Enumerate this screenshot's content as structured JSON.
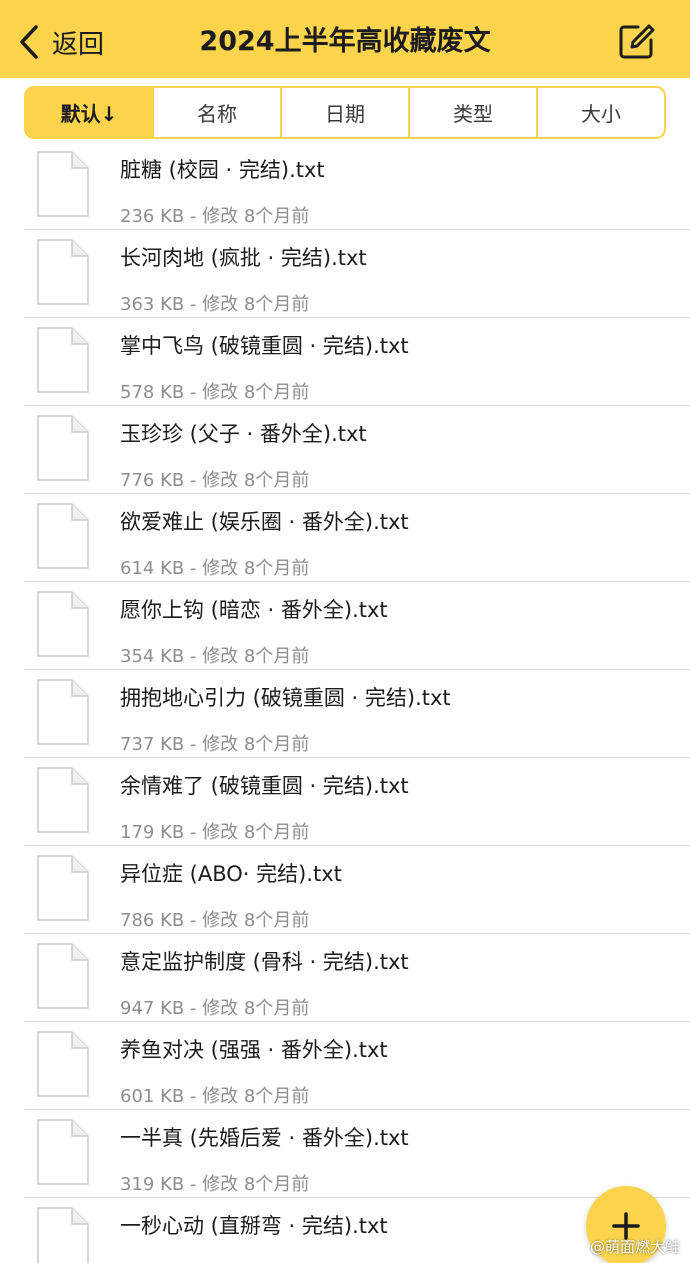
{
  "header": {
    "back_label": "返回",
    "title": "2024上半年高收藏废文",
    "background": "#fbd34c"
  },
  "sort_tabs": [
    {
      "label": "默认↓",
      "active": true
    },
    {
      "label": "名称",
      "active": false
    },
    {
      "label": "日期",
      "active": false
    },
    {
      "label": "类型",
      "active": false
    },
    {
      "label": "大小",
      "active": false
    }
  ],
  "files": [
    {
      "name": "脏糖 (校园 · 完结).txt",
      "meta": "236 KB - 修改 8个月前"
    },
    {
      "name": "长河肉地 (疯批 · 完结).txt",
      "meta": "363 KB - 修改 8个月前"
    },
    {
      "name": "掌中飞鸟 (破镜重圆 · 完结).txt",
      "meta": "578 KB - 修改 8个月前"
    },
    {
      "name": "玉珍珍 (父子 · 番外全).txt",
      "meta": "776 KB - 修改 8个月前"
    },
    {
      "name": "欲爱难止 (娱乐圈 · 番外全).txt",
      "meta": "614 KB - 修改 8个月前"
    },
    {
      "name": "愿你上钩 (暗恋 · 番外全).txt",
      "meta": "354 KB - 修改 8个月前"
    },
    {
      "name": "拥抱地心引力 (破镜重圆 · 完结).txt",
      "meta": "737 KB - 修改 8个月前"
    },
    {
      "name": "余情难了 (破镜重圆 · 完结).txt",
      "meta": "179 KB - 修改 8个月前"
    },
    {
      "name": "异位症 (ABO· 完结).txt",
      "meta": "786 KB - 修改 8个月前"
    },
    {
      "name": "意定监护制度 (骨科 · 完结).txt",
      "meta": "947 KB - 修改 8个月前"
    },
    {
      "name": "养鱼对决 (强强 · 番外全).txt",
      "meta": "601 KB - 修改 8个月前"
    },
    {
      "name": "一半真 (先婚后爱 · 番外全).txt",
      "meta": "319 KB - 修改 8个月前"
    },
    {
      "name": "一秒心动 (直掰弯 · 完结).txt",
      "meta": ""
    }
  ],
  "fab_icon": "plus-icon",
  "watermark": "@萌面燃大鲑"
}
